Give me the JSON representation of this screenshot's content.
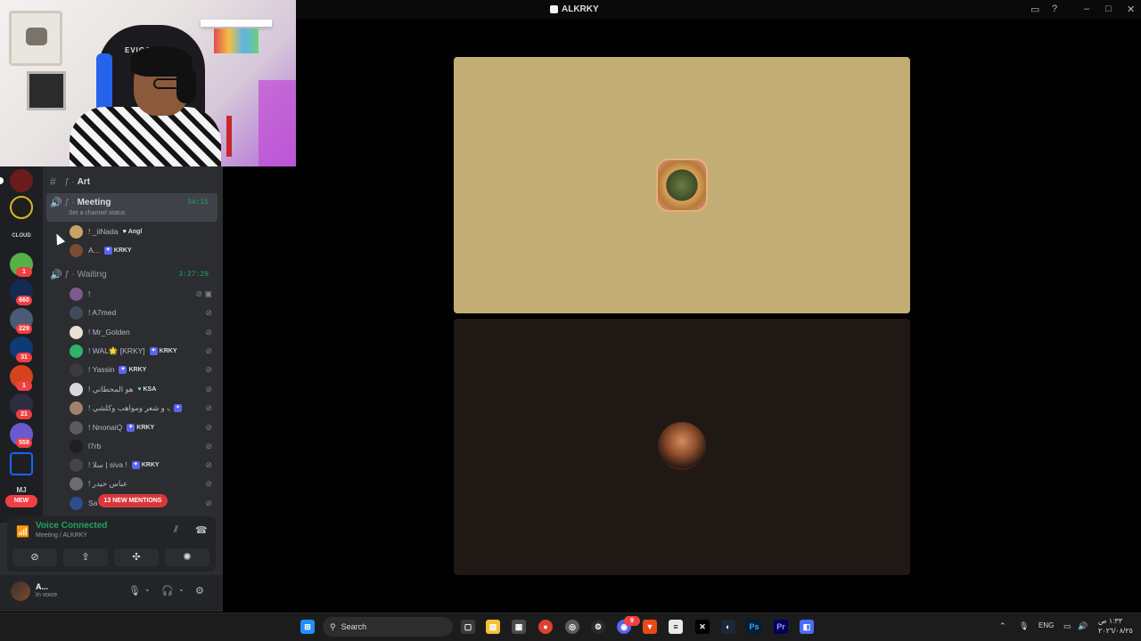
{
  "window": {
    "title": "ALKRKY"
  },
  "webcam": {
    "chair_brand": "EVIGO"
  },
  "servers": {
    "badges": [
      "1",
      "660",
      "229",
      "31",
      "1",
      "21",
      "558"
    ],
    "new_label": "NEW",
    "item_text": [
      "CLOUD",
      "MJ"
    ]
  },
  "channels": {
    "art": {
      "label": "Art"
    },
    "meeting": {
      "label": "Meeting",
      "timer": "34:15",
      "status": "Set a channel status"
    },
    "waiting": {
      "label": "Waiting",
      "timer": "3:27:29"
    }
  },
  "meeting_members": [
    {
      "name": "! _iiNada",
      "tag": "Angl",
      "tag_icon": "heart"
    },
    {
      "name": "A...",
      "tag": "KRKY",
      "tag_icon": "badge"
    }
  ],
  "waiting_members": [
    {
      "name": "!",
      "tag": ""
    },
    {
      "name": "! A7med",
      "tag": ""
    },
    {
      "name": "! Mr_Golden",
      "tag": ""
    },
    {
      "name": "! WAL🌟 [KRKY]",
      "tag": "KRKY"
    },
    {
      "name": "! Yassin",
      "tag": "KRKY"
    },
    {
      "name": "! هو المحطاني",
      "tag": "KSA"
    },
    {
      "name": "! عدي تحاب و شعر ومواهب وكلشي",
      "tag": ""
    },
    {
      "name": "! NnonaiQ",
      "tag": "KRKY"
    },
    {
      "name": "l7rb",
      "tag": ""
    },
    {
      "name": "! ﺳﻼ | siva !",
      "tag": "KRKY"
    },
    {
      "name": "! عباس حيدر",
      "tag": ""
    },
    {
      "name": "Sa",
      "tag": ""
    }
  ],
  "mentions_pill": "13 NEW MENTIONS",
  "voice": {
    "status": "Voice Connected",
    "location": "Meeting / ALKRKY"
  },
  "user": {
    "name": "A...",
    "status": "In voice"
  },
  "taskbar": {
    "search_placeholder": "Search",
    "lang": "ENG",
    "time": "١:٣٣ ص",
    "date": "٢٠٢٦/٠٨/٢٥",
    "discord_badge": "9"
  },
  "colors": {
    "online_green": "#23a55a",
    "danger_red": "#f23f43",
    "tile_top": "#c2ae74",
    "tile_bottom": "#201814"
  }
}
